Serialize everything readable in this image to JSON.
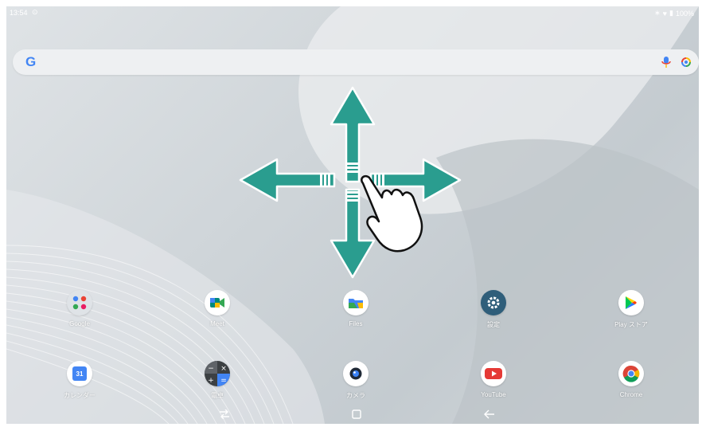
{
  "status_bar": {
    "time": "13:54",
    "battery": "100%"
  },
  "search_bar": {
    "logo": "G",
    "left_icon": "google-g-icon",
    "right_icons": [
      "mic-icon",
      "lens-icon"
    ]
  },
  "overlay": {
    "description_icons": [
      "arrow-up-icon",
      "arrow-down-icon",
      "arrow-left-icon",
      "arrow-right-icon",
      "hand-pointer-icon"
    ],
    "arrow_color": "#2a9d8f",
    "outline_color": "#ffffff"
  },
  "apps": [
    {
      "label": "Google",
      "icon": "google-folder-icon"
    },
    {
      "label": "Meet",
      "icon": "meet-icon"
    },
    {
      "label": "Files",
      "icon": "files-icon"
    },
    {
      "label": "設定",
      "icon": "settings-icon"
    },
    {
      "label": "Play ストア",
      "icon": "play-store-icon"
    },
    {
      "label": "カレンダー",
      "icon": "calendar-icon"
    },
    {
      "label": "電卓",
      "icon": "calculator-icon"
    },
    {
      "label": "カメラ",
      "icon": "camera-icon"
    },
    {
      "label": "YouTube",
      "icon": "youtube-icon"
    },
    {
      "label": "Chrome",
      "icon": "chrome-icon"
    }
  ],
  "calendar_day": "31",
  "nav_bar": {
    "buttons": [
      "recents-icon",
      "home-icon",
      "back-icon"
    ]
  },
  "colors": {
    "settings": "#2f5e7a",
    "youtube": "#e53935",
    "teal_arrow": "#2a9d8f"
  }
}
